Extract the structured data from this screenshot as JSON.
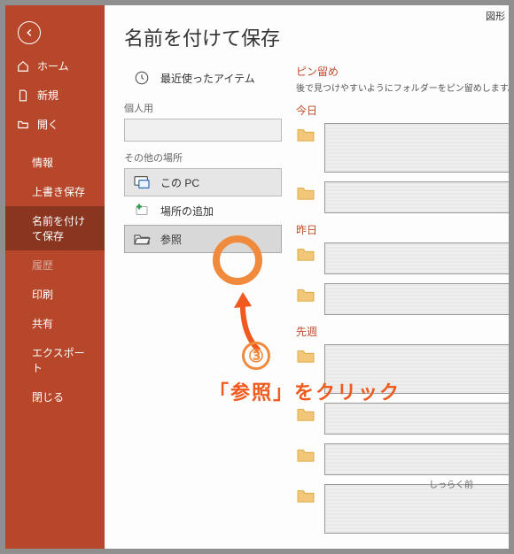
{
  "topright": "図形",
  "title": "名前を付けて保存",
  "sidebar": {
    "items": [
      {
        "label": "ホーム"
      },
      {
        "label": "新規"
      },
      {
        "label": "開く"
      },
      {
        "label": "情報"
      },
      {
        "label": "上書き保存"
      },
      {
        "label": "名前を付けて保存"
      },
      {
        "label": "履歴"
      },
      {
        "label": "印刷"
      },
      {
        "label": "共有"
      },
      {
        "label": "エクスポート"
      },
      {
        "label": "閉じる"
      }
    ]
  },
  "middle": {
    "recent": "最近使ったアイテム",
    "personal": "個人用",
    "other": "その他の場所",
    "thispc": "この PC",
    "addlocation": "場所の追加",
    "browse": "参照"
  },
  "right": {
    "pin_title": "ピン留め",
    "pin_note": "後で見つけやすいようにフォルダーをピン留めします。フォルダーにマウス オ",
    "group1": "今日",
    "group2": "昨日",
    "group3": "先週",
    "tiny": "しっらく前"
  },
  "anno": {
    "num": "③",
    "text": "「参照」をクリック"
  }
}
